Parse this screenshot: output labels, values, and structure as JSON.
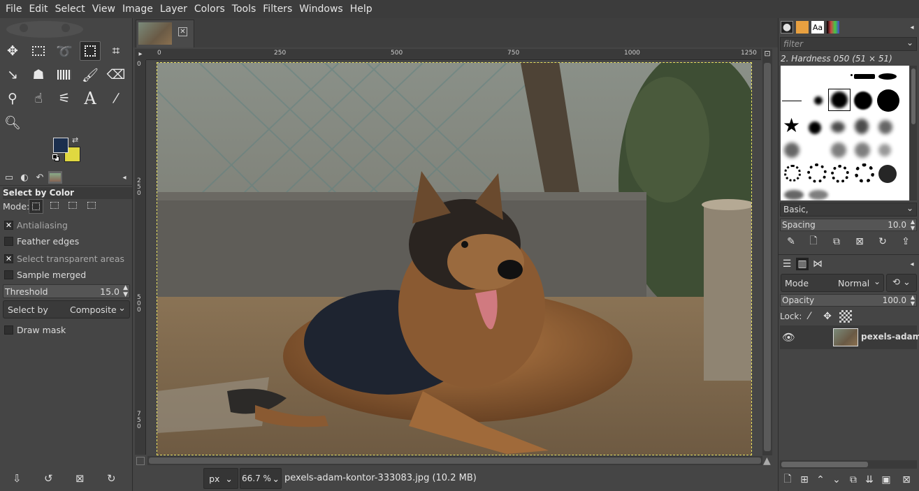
{
  "menu": [
    "File",
    "Edit",
    "Select",
    "View",
    "Image",
    "Layer",
    "Colors",
    "Tools",
    "Filters",
    "Windows",
    "Help"
  ],
  "colors": {
    "foreground": "#1b2f4e",
    "background": "#e0d840",
    "accent": "#e8e060"
  },
  "tool_options": {
    "title": "Select by Color",
    "mode_label": "Mode:",
    "checks": [
      {
        "label": "Antialiasing",
        "checked": true,
        "enabled": false
      },
      {
        "label": "Feather edges",
        "checked": false,
        "enabled": true
      },
      {
        "label": "Select transparent areas",
        "checked": true,
        "enabled": false
      },
      {
        "label": "Sample merged",
        "checked": false,
        "enabled": true
      }
    ],
    "threshold_label": "Threshold",
    "threshold_value": "15.0",
    "select_by_label": "Select by",
    "select_by_value": "Composite",
    "draw_mask": "Draw mask"
  },
  "ruler": {
    "top": [
      "0",
      "250",
      "500",
      "750",
      "1000",
      "1250"
    ],
    "left": [
      "0",
      "250",
      "500",
      "750"
    ]
  },
  "status": {
    "unit": "px",
    "zoom": "66.7 %",
    "file": "pexels-adam-kontor-333083.jpg (10.2 MB)"
  },
  "brushes": {
    "filter_placeholder": "filter",
    "selected_name": "2. Hardness 050 (51 × 51)",
    "tag": "Basic,",
    "spacing_label": "Spacing",
    "spacing_value": "10.0"
  },
  "layers": {
    "mode_label": "Mode",
    "mode_value": "Normal",
    "opacity_label": "Opacity",
    "opacity_value": "100.0",
    "lock_label": "Lock:",
    "layer_name": "pexels-adam-k"
  }
}
